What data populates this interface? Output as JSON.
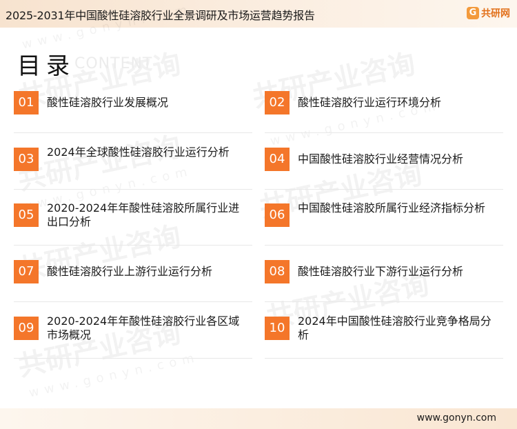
{
  "header": {
    "title": "2025-2031年中国酸性硅溶胶行业全景调研及市场运营趋势报告",
    "brand_icon": "G",
    "brand_name": "共研网"
  },
  "toc": {
    "heading": "目录",
    "subheading": "CONTENT",
    "items": [
      {
        "num": "01",
        "label": "酸性硅溶胶行业发展概况"
      },
      {
        "num": "02",
        "label": "酸性硅溶胶行业运行环境分析"
      },
      {
        "num": "03",
        "label": "2024年全球酸性硅溶胶行业运行分析"
      },
      {
        "num": "04",
        "label": "中国酸性硅溶胶行业经营情况分析"
      },
      {
        "num": "05",
        "label": "2020-2024年年酸性硅溶胶所属行业进出口分析"
      },
      {
        "num": "06",
        "label": "中国酸性硅溶胶所属行业经济指标分析"
      },
      {
        "num": "07",
        "label": "酸性硅溶胶行业上游行业运行分析"
      },
      {
        "num": "08",
        "label": "酸性硅溶胶行业下游行业运行分析"
      },
      {
        "num": "09",
        "label": "2020-2024年年酸性硅溶胶行业各区域市场概况"
      },
      {
        "num": "10",
        "label": "2024年中国酸性硅溶胶行业竞争格局分析"
      }
    ]
  },
  "watermark": {
    "text": "共研产业咨询",
    "url": "www.gonyn.com"
  },
  "footer": {
    "url": "www.gonyn.com"
  },
  "colors": {
    "accent": "#f4762a",
    "header_bg": "#f7e3cf"
  }
}
